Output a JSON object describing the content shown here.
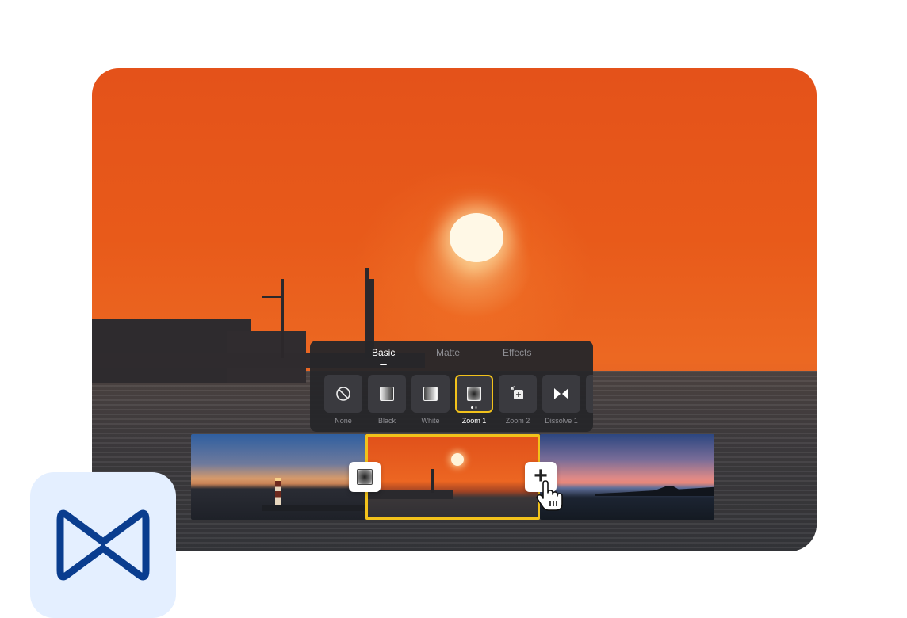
{
  "panel": {
    "tabs": [
      {
        "label": "Basic",
        "active": true
      },
      {
        "label": "Matte",
        "active": false
      },
      {
        "label": "Effects",
        "active": false
      }
    ],
    "transitions": [
      {
        "label": "None",
        "icon": "none-icon"
      },
      {
        "label": "Black",
        "icon": "fade-black-icon"
      },
      {
        "label": "White",
        "icon": "fade-white-icon"
      },
      {
        "label": "Zoom 1",
        "icon": "zoom-in-icon",
        "selected": true
      },
      {
        "label": "Zoom 2",
        "icon": "zoom-out-icon"
      },
      {
        "label": "Dissolve 1",
        "icon": "dissolve-icon"
      }
    ]
  },
  "timeline": {
    "clips": [
      {
        "name": "lighthouse-dusk"
      },
      {
        "name": "sunset-pier",
        "selected": true
      },
      {
        "name": "pink-sky-shore"
      }
    ]
  },
  "colors": {
    "accent": "#f2c21b",
    "panel_bg": "#26262a",
    "logo_bg": "#e4efff",
    "logo_stroke": "#0a3d8f"
  }
}
